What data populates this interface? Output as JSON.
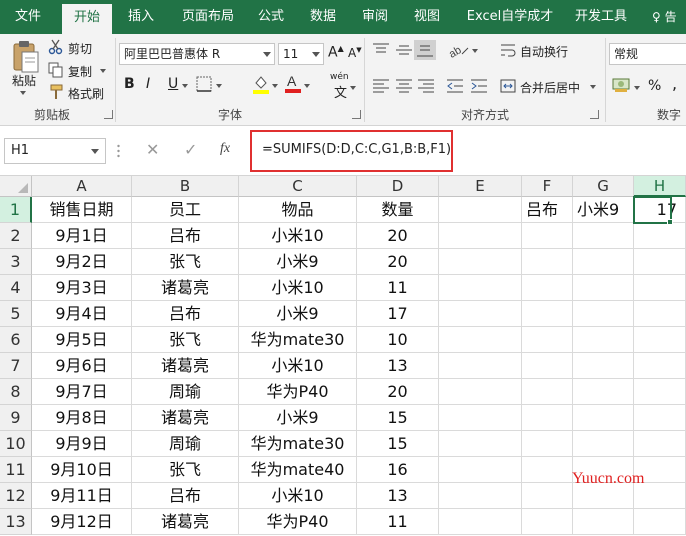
{
  "tabs": [
    {
      "label": "文件",
      "active": false
    },
    {
      "label": "开始",
      "active": true
    },
    {
      "label": "插入",
      "active": false
    },
    {
      "label": "页面布局",
      "active": false
    },
    {
      "label": "公式",
      "active": false
    },
    {
      "label": "数据",
      "active": false
    },
    {
      "label": "审阅",
      "active": false
    },
    {
      "label": "视图",
      "active": false
    },
    {
      "label": "Excel自学成才",
      "active": false
    },
    {
      "label": "开发工具",
      "active": false
    }
  ],
  "help_label": "♀ 告",
  "ribbon": {
    "clipboard": {
      "paste_label": "粘贴",
      "cut_label": "剪切",
      "copy_label": "复制",
      "format_painter_label": "格式刷",
      "group_label": "剪贴板"
    },
    "font": {
      "font_name": "阿里巴巴普惠体 R",
      "font_size": "11",
      "bold": "B",
      "italic": "I",
      "underline": "U",
      "font_color_letter": "A",
      "wen_label": "wén",
      "group_label": "字体"
    },
    "alignment": {
      "wrap_label": "自动换行",
      "merge_label": "合并后居中",
      "group_label": "对齐方式"
    },
    "number": {
      "format": "常规",
      "percent": "%",
      "group_label": "数字"
    }
  },
  "formula_bar": {
    "name_box": "H1",
    "cancel_glyph": "✕",
    "enter_glyph": "✓",
    "fx_glyph": "fx",
    "formula": "=SUMIFS(D:D,C:C,G1,B:B,F1)"
  },
  "sheet": {
    "columns": [
      "A",
      "B",
      "C",
      "D",
      "E",
      "F",
      "G",
      "H"
    ],
    "selected_column": "H",
    "selected_row": 1,
    "rows": [
      {
        "n": "1",
        "A": "销售日期",
        "B": "员工",
        "C": "物品",
        "D": "数量",
        "F": "吕布",
        "G": "小米9",
        "H": "17"
      },
      {
        "n": "2",
        "A": "9月1日",
        "B": "吕布",
        "C": "小米10",
        "D": "20"
      },
      {
        "n": "3",
        "A": "9月2日",
        "B": "张飞",
        "C": "小米9",
        "D": "20"
      },
      {
        "n": "4",
        "A": "9月3日",
        "B": "诸葛亮",
        "C": "小米10",
        "D": "11"
      },
      {
        "n": "5",
        "A": "9月4日",
        "B": "吕布",
        "C": "小米9",
        "D": "17"
      },
      {
        "n": "6",
        "A": "9月5日",
        "B": "张飞",
        "C": "华为mate30",
        "D": "10"
      },
      {
        "n": "7",
        "A": "9月6日",
        "B": "诸葛亮",
        "C": "小米10",
        "D": "13"
      },
      {
        "n": "8",
        "A": "9月7日",
        "B": "周瑜",
        "C": "华为P40",
        "D": "20"
      },
      {
        "n": "9",
        "A": "9月8日",
        "B": "诸葛亮",
        "C": "小米9",
        "D": "15"
      },
      {
        "n": "10",
        "A": "9月9日",
        "B": "周瑜",
        "C": "华为mate30",
        "D": "15"
      },
      {
        "n": "11",
        "A": "9月10日",
        "B": "张飞",
        "C": "华为mate40",
        "D": "16"
      },
      {
        "n": "12",
        "A": "9月11日",
        "B": "吕布",
        "C": "小米10",
        "D": "13"
      },
      {
        "n": "13",
        "A": "9月12日",
        "B": "诸葛亮",
        "C": "华为P40",
        "D": "11"
      }
    ]
  },
  "watermark": "Yuucn.com",
  "colors": {
    "accent": "#217346",
    "highlight_border": "#e03030"
  }
}
